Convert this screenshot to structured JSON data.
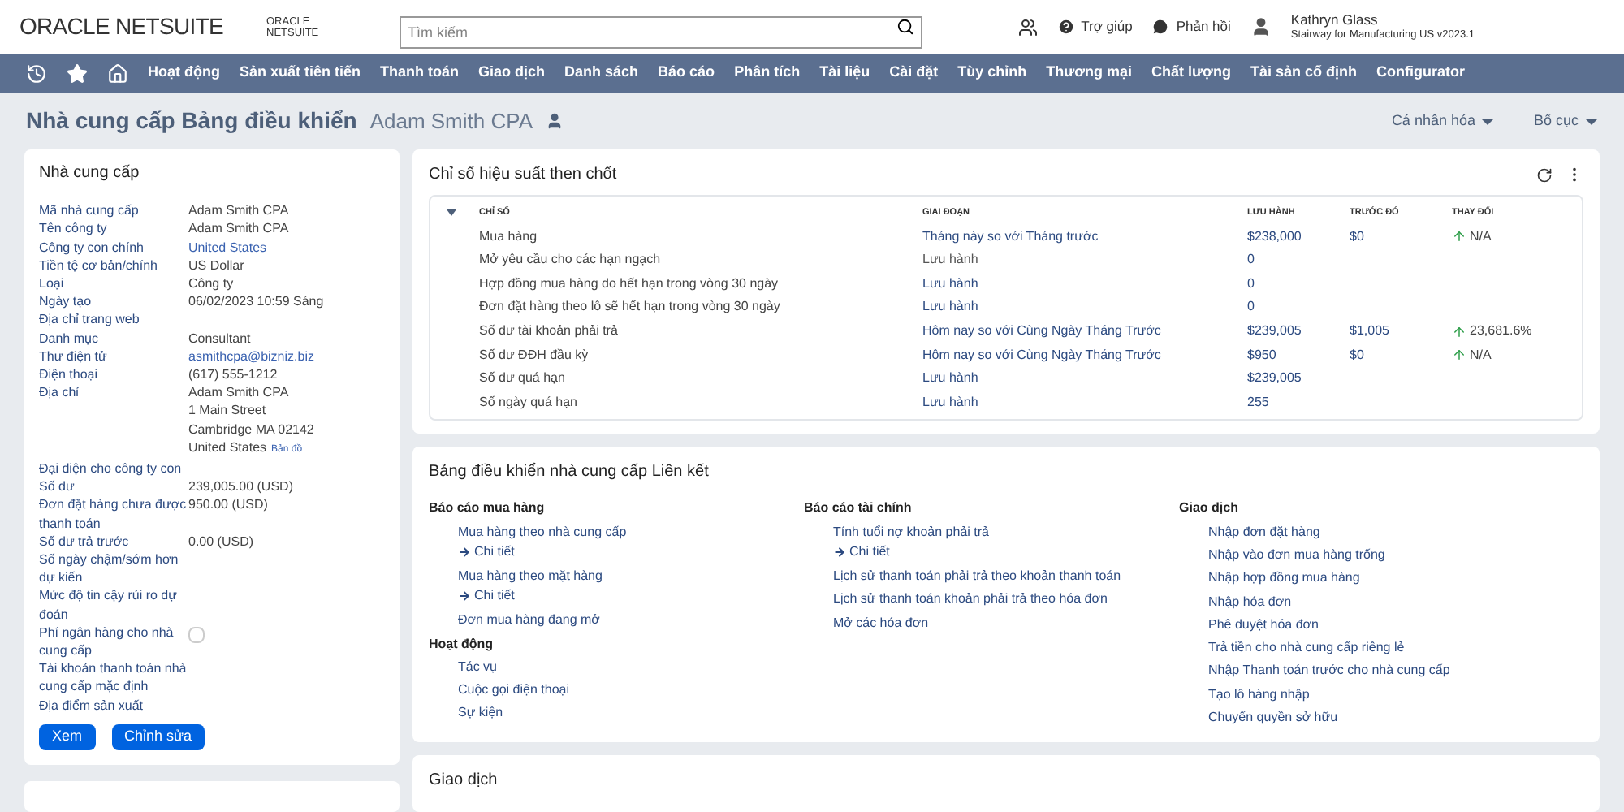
{
  "header": {
    "logo": "ORACLE NETSUITE",
    "small_logo": [
      "ORACLE",
      "NETSUITE"
    ],
    "search": {
      "placeholder": "Tìm kiếm"
    },
    "help": "Trợ giúp",
    "feedback": "Phản hồi",
    "user": {
      "name": "Kathryn Glass",
      "role": "Stairway for Manufacturing US v2023.1"
    }
  },
  "nav": [
    "Hoạt động",
    "Sản xuất tiên tiến",
    "Thanh toán",
    "Giao dịch",
    "Danh sách",
    "Báo cáo",
    "Phân tích",
    "Tài liệu",
    "Cài đặt",
    "Tùy chỉnh",
    "Thương mại",
    "Chất lượng",
    "Tài sản cố định",
    "Configurator"
  ],
  "page": {
    "title": "Nhà cung cấp Bảng điều khiển",
    "subtitle": "Adam Smith CPA",
    "personalize": "Cá nhân hóa",
    "layout": "Bố cục"
  },
  "vendor": {
    "title": "Nhà cung cấp",
    "fields": [
      {
        "label": "Mã nhà cung cấp",
        "value": [
          "Adam Smith CPA"
        ]
      },
      {
        "label": "Tên công ty",
        "value": [
          "Adam Smith CPA"
        ]
      },
      {
        "label": "Công ty con chính",
        "value": [
          "United States"
        ],
        "link": true
      },
      {
        "label": "Tiền tệ cơ bản/chính",
        "value": [
          "US Dollar"
        ]
      },
      {
        "label": "Loại",
        "value": [
          "Công ty"
        ]
      },
      {
        "label": "Ngày tạo",
        "value": [
          "06/02/2023 10:59 Sáng"
        ]
      },
      {
        "label": "Địa chỉ trang web"
      },
      {
        "label": "Danh mục",
        "value": [
          "Consultant"
        ]
      },
      {
        "label": "Thư điện tử",
        "value": [
          "asmithcpa@bizniz.biz"
        ],
        "link": true
      },
      {
        "label": "Điện thoại",
        "value": [
          "(617) 555-1212"
        ]
      },
      {
        "label": "Địa chỉ",
        "value": [
          "Adam Smith CPA",
          "1 Main Street",
          "Cambridge MA 02142",
          "United States"
        ],
        "map": "Bản đồ"
      },
      {
        "label": "Đại diện cho công ty con"
      },
      {
        "label": "Số dư",
        "value": [
          "239,005.00 (USD)"
        ]
      },
      {
        "label": "Đơn đặt hàng chưa được thanh toán",
        "value": [
          "950.00 (USD)"
        ]
      },
      {
        "label": "Số dư trả trước",
        "value": [
          "0.00 (USD)"
        ]
      },
      {
        "label": "Số ngày chậm/sớm hơn dự kiến"
      },
      {
        "label": "Mức độ tin cậy rủi ro dự đoán"
      },
      {
        "label": "Phí ngân hàng cho nhà cung cấp",
        "checked": false
      },
      {
        "label": "Tài khoản thanh toán nhà cung cấp mặc định"
      },
      {
        "label": "Địa điểm sản xuất"
      }
    ],
    "buttons": [
      "Xem",
      "Chỉnh sửa"
    ]
  },
  "kpi": {
    "title": "Chỉ số hiệu suất then chốt",
    "columns": [
      "CHỈ SỐ",
      "GIAI ĐOẠN",
      "LƯU HÀNH",
      "TRƯỚC ĐÓ",
      "THAY ĐỔI"
    ],
    "rows": [
      {
        "name": "Mua hàng",
        "period": "Tháng này so với Tháng trước",
        "period_link": true,
        "current": "$238,000",
        "previous": "$0",
        "change": "N/A",
        "rising": true
      },
      {
        "name": "Mở yêu cầu cho các hạn ngạch",
        "period": "Lưu hành",
        "period_link": false,
        "current": "0"
      },
      {
        "name": "Hợp đồng mua hàng do hết hạn trong vòng 30 ngày",
        "period": "Lưu hành",
        "period_link": true,
        "current": "0"
      },
      {
        "name": "Đơn đặt hàng theo lô sẽ hết hạn trong vòng 30 ngày",
        "period": "Lưu hành",
        "period_link": true,
        "current": "0"
      },
      {
        "name": "Số dư tài khoản phải trả",
        "period": "Hôm nay so với Cùng Ngày Tháng Trước",
        "period_link": true,
        "current": "$239,005",
        "previous": "$1,005",
        "change": "23,681.6%",
        "rising": true
      },
      {
        "name": "Số dư ĐĐH đầu kỳ",
        "period": "Hôm nay so với Cùng Ngày Tháng Trước",
        "period_link": true,
        "current": "$950",
        "previous": "$0",
        "change": "N/A",
        "rising": true
      },
      {
        "name": "Số dư quá hạn",
        "period": "Lưu hành",
        "period_link": true,
        "current": "$239,005"
      },
      {
        "name": "Số ngày quá hạn",
        "period": "Lưu hành",
        "period_link": true,
        "current": "255"
      }
    ]
  },
  "links": {
    "title": "Bảng điều khiển nhà cung cấp Liên kết",
    "columns": [
      {
        "sections": [
          {
            "heading": "Báo cáo mua hàng",
            "items": [
              {
                "label": "Mua hàng theo nhà cung cấp",
                "detail": "Chi tiết"
              },
              {
                "label": "Mua hàng theo mặt hàng",
                "detail": "Chi tiết"
              },
              {
                "label": "Đơn mua hàng đang mở"
              }
            ]
          },
          {
            "heading": "Hoạt động",
            "items": [
              {
                "label": "Tác vụ"
              },
              {
                "label": "Cuộc gọi điện thoại"
              },
              {
                "label": "Sự kiện"
              }
            ]
          }
        ]
      },
      {
        "sections": [
          {
            "heading": "Báo cáo tài chính",
            "items": [
              {
                "label": "Tính tuổi nợ khoản phải trả",
                "detail": "Chi tiết"
              },
              {
                "label": "Lịch sử thanh toán phải trả theo khoản thanh toán"
              },
              {
                "label": "Lịch sử thanh toán khoản phải trả theo hóa đơn"
              },
              {
                "label": "Mở các hóa đơn"
              }
            ]
          }
        ]
      },
      {
        "sections": [
          {
            "heading": "Giao dịch",
            "items": [
              {
                "label": "Nhập đơn đặt hàng"
              },
              {
                "label": "Nhập vào đơn mua hàng trống"
              },
              {
                "label": "Nhập hợp đồng mua hàng"
              },
              {
                "label": "Nhập hóa đơn"
              },
              {
                "label": "Phê duyệt hóa đơn"
              },
              {
                "label": "Trả tiền cho nhà cung cấp riêng lẻ"
              },
              {
                "label": "Nhập Thanh toán trước cho nhà cung cấp"
              },
              {
                "label": "Tạo lô hàng nhập"
              },
              {
                "label": "Chuyển quyền sở hữu"
              }
            ]
          }
        ]
      }
    ]
  },
  "transactions": {
    "title": "Giao dịch"
  }
}
